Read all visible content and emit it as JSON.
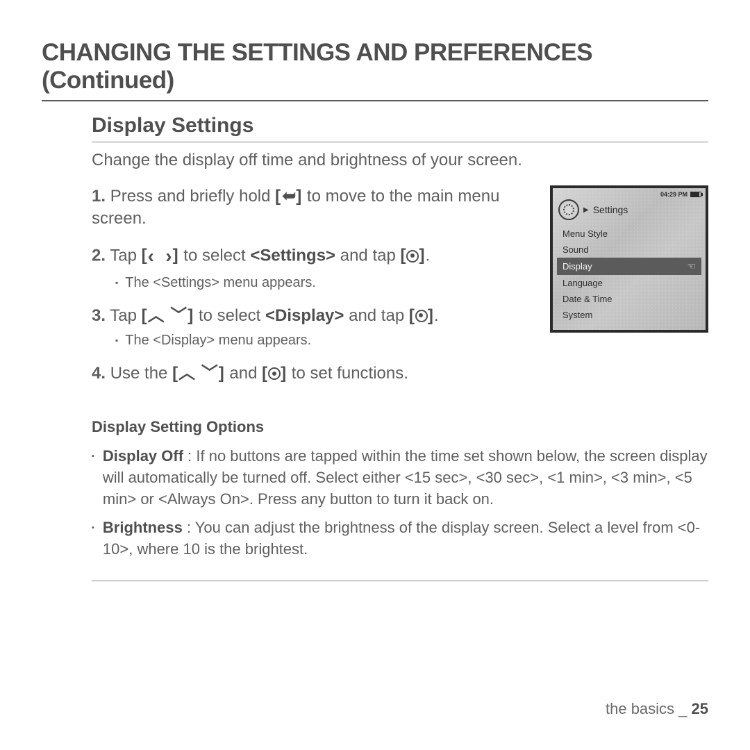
{
  "heading": "CHANGING THE SETTINGS AND PREFERENCES (Continued)",
  "subheading": "Display Settings",
  "intro": "Change the display off time and brightness of your screen.",
  "steps": {
    "s1_pre": "Press and briefly hold ",
    "s1_post": " to move to the main menu screen.",
    "s2_pre": "Tap ",
    "s2_mid": " to select ",
    "s2_bold": "<Settings>",
    "s2_post": " and tap ",
    "s2_sub": "The <Settings> menu appears.",
    "s3_pre": "Tap ",
    "s3_mid": " to select ",
    "s3_bold": "<Display>",
    "s3_post": " and tap ",
    "s3_sub": "The <Display> menu appears.",
    "s4_pre": "Use the ",
    "s4_mid": " and ",
    "s4_post": " to set functions."
  },
  "keys": {
    "back": "[↩]",
    "lr_open": "[",
    "lr_left": "‹",
    "lr_right": "›",
    "lr_close": "]",
    "ud_up": "︿",
    "ud_down": "﹀",
    "dot_open": "[",
    "dot_close": "]"
  },
  "options_heading": "Display Setting Options",
  "options": {
    "o1_bold": "Display Off",
    "o1_text": " : If no buttons are tapped within the time set shown below, the screen display will automatically be turned off. Select either <15 sec>, <30 sec>, <1 min>, <3 min>, <5 min> or <Always On>. Press any button to turn it back on.",
    "o2_bold": "Brightness",
    "o2_text": " : You can adjust the brightness of the display screen. Select a level from <0-10>, where 10 is the brightest."
  },
  "device": {
    "time": "04:29 PM",
    "title": "Settings",
    "items": [
      "Menu Style",
      "Sound",
      "Display",
      "Language",
      "Date & Time",
      "System"
    ],
    "selected": "Display"
  },
  "footer": {
    "section": "the basics _ ",
    "page": "25"
  }
}
